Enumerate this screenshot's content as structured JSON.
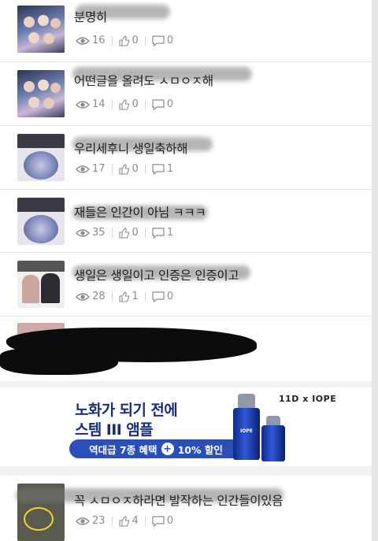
{
  "posts": [
    {
      "title": "분명히",
      "views": "16",
      "likes": "0",
      "comments": "0"
    },
    {
      "title": "어떤글을 올려도 ㅅㅁㅇㅈ해",
      "views": "14",
      "likes": "0",
      "comments": "0"
    },
    {
      "title": "우리세후니 생일축하해",
      "views": "17",
      "likes": "0",
      "comments": "1"
    },
    {
      "title": "재들은 인간이 아님 ㅋㅋㅋ",
      "views": "35",
      "likes": "0",
      "comments": "1"
    },
    {
      "title": "생일은 생일이고 인증은 인증이고",
      "views": "28",
      "likes": "1",
      "comments": "0"
    },
    {
      "title": "꼭 ㅅㅁㅇㅈ하라면 발작하는 인간들이있음",
      "views": "23",
      "likes": "4",
      "comments": "0"
    }
  ],
  "ad": {
    "line1": "노화가 되기 전에",
    "line2": "스템 III 앰플",
    "pill_left": "역대급 7종 혜택",
    "pill_plus": "+",
    "pill_right": "10% 할인",
    "brand": "11D x IOPE",
    "bottle_label": "IOPE",
    "accent": "#1a2f74",
    "pill_color": "#2a4fb8"
  },
  "icons": {
    "views": "eye-icon",
    "likes": "thumbs-up-icon",
    "comments": "comment-icon"
  }
}
